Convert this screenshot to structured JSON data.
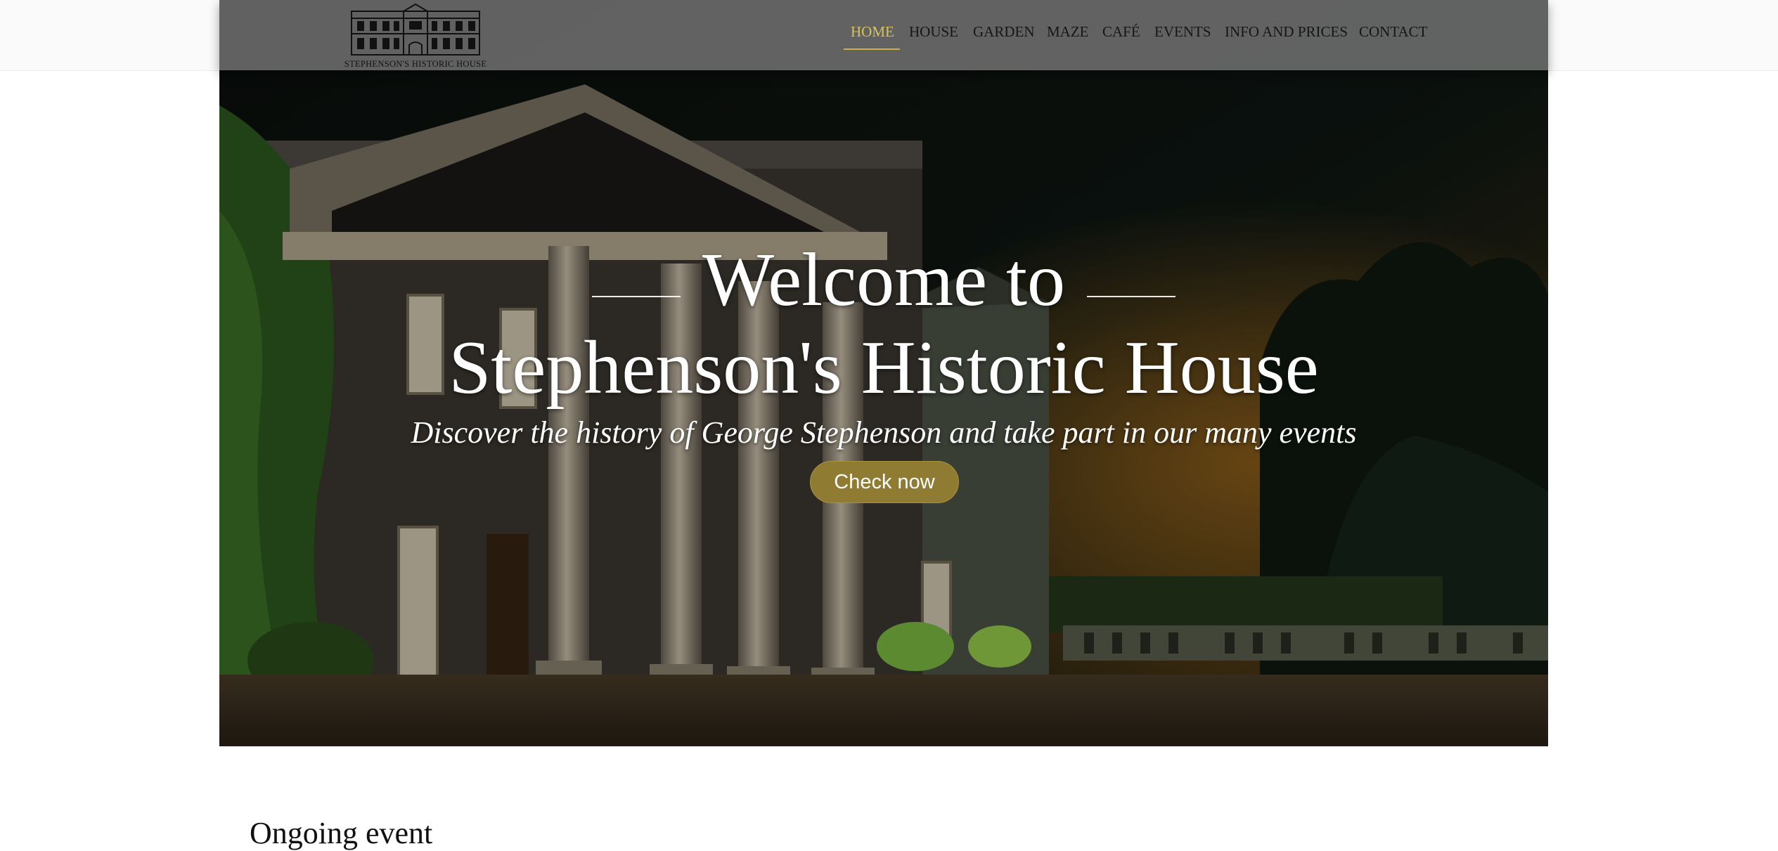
{
  "header": {
    "logo_text": "STEPHENSON'S HISTORIC HOUSE",
    "nav": [
      {
        "label": "HOME",
        "active": true
      },
      {
        "label": "HOUSE",
        "active": false
      },
      {
        "label": "GARDEN",
        "active": false
      },
      {
        "label": "MAZE",
        "active": false
      },
      {
        "label": "CAFÉ",
        "active": false
      },
      {
        "label": "EVENTS",
        "active": false
      },
      {
        "label": "INFO AND PRICES",
        "active": false
      },
      {
        "label": "CONTACT",
        "active": false
      }
    ]
  },
  "hero": {
    "title_line1": "Welcome to",
    "title_line2": "Stephenson's Historic House",
    "subtitle": "Discover the history of George Stephenson and take part in our many events",
    "cta_label": "Check now"
  },
  "main": {
    "section_heading": "Ongoing event"
  },
  "colors": {
    "accent": "#d8c25a",
    "cta": "#8f7b31",
    "header_bg": "#696969"
  }
}
